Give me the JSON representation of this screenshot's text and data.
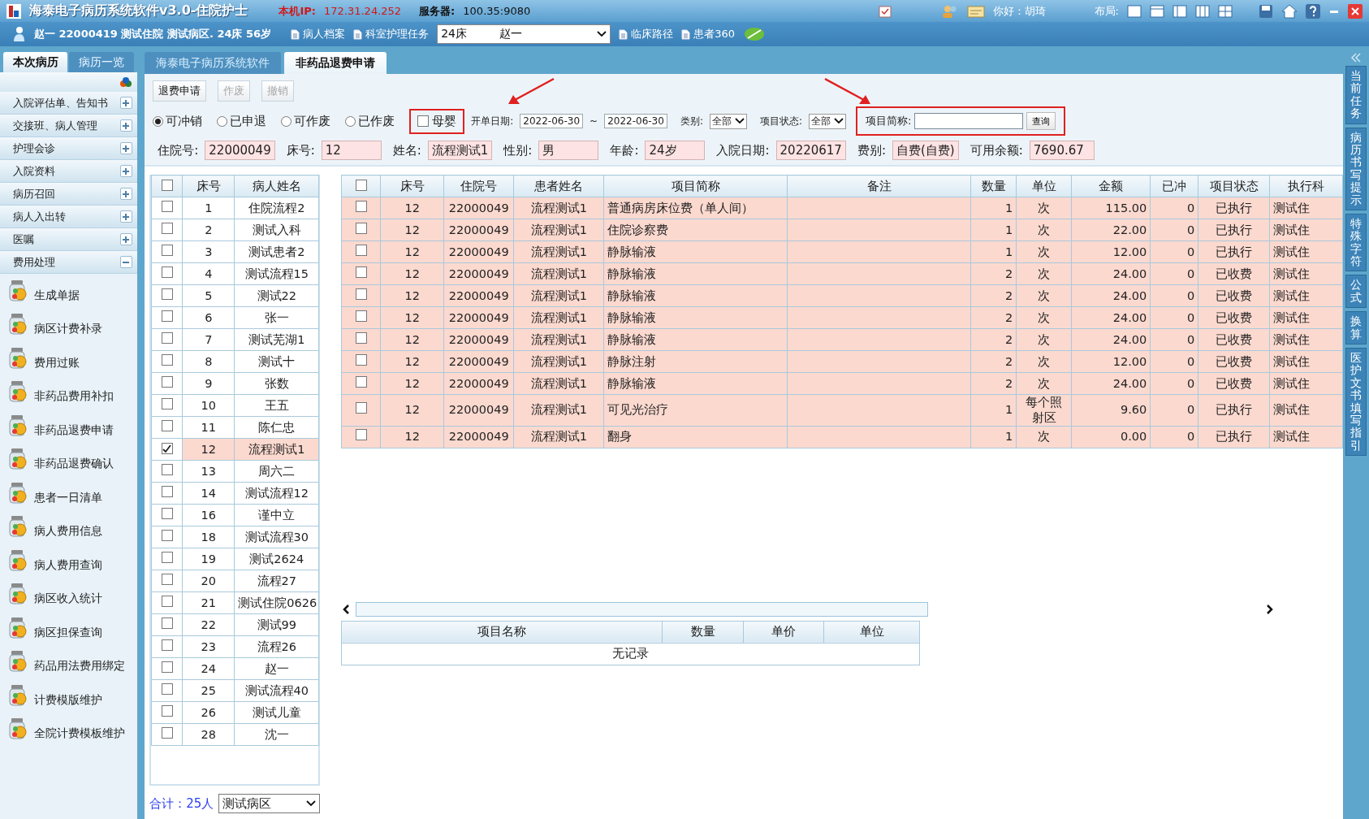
{
  "title_bar": {
    "app_title": "海泰电子病历系统软件v3.0-住院护士",
    "ip_label": "本机IP:",
    "ip": "172.31.24.252",
    "server_label": "服务器:",
    "server": "100.35:9080",
    "greeting": "你好：胡琦",
    "layout_label": "布局:"
  },
  "patient_bar": {
    "patient_info": "赵一  22000419  测试住院  测试病区. 24床  56岁",
    "links_left": [
      "病人档案",
      "科室护理任务"
    ],
    "bed_select": {
      "bed": "24床",
      "name": "赵一"
    },
    "links_right": [
      "临床路径",
      "患者360"
    ]
  },
  "sidebar": {
    "tabs": [
      {
        "label": "本次病历",
        "selected": true
      },
      {
        "label": "病历一览",
        "selected": false
      }
    ],
    "sections": [
      {
        "label": "入院评估单、告知书",
        "expanded": false
      },
      {
        "label": "交接班、病人管理",
        "expanded": false
      },
      {
        "label": "护理会诊",
        "expanded": false
      },
      {
        "label": "入院资料",
        "expanded": false
      },
      {
        "label": "病历召回",
        "expanded": false
      },
      {
        "label": "病人入出转",
        "expanded": false
      },
      {
        "label": "医嘱",
        "expanded": false
      },
      {
        "label": "费用处理",
        "expanded": true,
        "children": [
          "生成单据",
          "病区计费补录",
          "费用过账",
          "非药品费用补扣",
          "非药品退费申请",
          "非药品退费确认",
          "患者一日清单",
          "病人费用信息",
          "病人费用查询",
          "病区收入统计",
          "病区担保查询",
          "药品用法费用绑定",
          "计费模版维护",
          "全院计费模板维护"
        ]
      }
    ]
  },
  "content_tabs": [
    {
      "label": "海泰电子病历系统软件",
      "selected": false
    },
    {
      "label": "非药品退费申请",
      "selected": true
    }
  ],
  "toolbar": {
    "buttons": [
      {
        "label": "退费申请",
        "disabled": false
      },
      {
        "label": "作废",
        "disabled": true
      },
      {
        "label": "撤销",
        "disabled": true
      }
    ]
  },
  "filters": {
    "radios": [
      {
        "label": "可冲销",
        "selected": true
      },
      {
        "label": "已申退",
        "selected": false
      },
      {
        "label": "可作废",
        "selected": false
      },
      {
        "label": "已作废",
        "selected": false
      }
    ],
    "mother_baby": {
      "label": "母婴",
      "checked": false
    },
    "date_label": "开单日期:",
    "date_from": "2022-06-30",
    "date_separator": "~",
    "date_to": "2022-06-30",
    "category_label": "类别:",
    "category": "全部",
    "status_label": "项目状态:",
    "status": "全部",
    "item_label": "项目简称:",
    "query_button": "查询"
  },
  "patient_info": [
    {
      "label": "住院号:",
      "value": "22000049"
    },
    {
      "label": "床号:",
      "value": "12"
    },
    {
      "label": "姓名:",
      "value": "流程测试1"
    },
    {
      "label": "性别:",
      "value": "男"
    },
    {
      "label": "年龄:",
      "value": "24岁"
    },
    {
      "label": "入院日期:",
      "value": "20220617"
    },
    {
      "label": "费别:",
      "value": "自费(自费)"
    },
    {
      "label": "可用余额:",
      "value": "7690.67"
    }
  ],
  "patient_list": {
    "all_checked": false,
    "columns": [
      "床号",
      "病人姓名"
    ],
    "rows": [
      {
        "bed": "1",
        "name": "住院流程2",
        "checked": false
      },
      {
        "bed": "2",
        "name": "测试入科",
        "checked": false
      },
      {
        "bed": "3",
        "name": "测试患者2",
        "checked": false
      },
      {
        "bed": "4",
        "name": "测试流程15",
        "checked": false
      },
      {
        "bed": "5",
        "name": "测试22",
        "checked": false
      },
      {
        "bed": "6",
        "name": "张一",
        "checked": false
      },
      {
        "bed": "7",
        "name": "测试芜湖1",
        "checked": false
      },
      {
        "bed": "8",
        "name": "测试十",
        "checked": false
      },
      {
        "bed": "9",
        "name": "张数",
        "checked": false
      },
      {
        "bed": "10",
        "name": "王五",
        "checked": false
      },
      {
        "bed": "11",
        "name": "陈仁忠",
        "checked": false
      },
      {
        "bed": "12",
        "name": "流程测试1",
        "checked": true
      },
      {
        "bed": "13",
        "name": "周六二",
        "checked": false
      },
      {
        "bed": "14",
        "name": "测试流程12",
        "checked": false
      },
      {
        "bed": "16",
        "name": "谨中立",
        "checked": false
      },
      {
        "bed": "18",
        "name": "测试流程30",
        "checked": false
      },
      {
        "bed": "19",
        "name": "测试2624",
        "checked": false
      },
      {
        "bed": "20",
        "name": "流程27",
        "checked": false
      },
      {
        "bed": "21",
        "name": "测试住院0626",
        "checked": false
      },
      {
        "bed": "22",
        "name": "测试99",
        "checked": false
      },
      {
        "bed": "23",
        "name": "流程26",
        "checked": false
      },
      {
        "bed": "24",
        "name": "赵一",
        "checked": false
      },
      {
        "bed": "25",
        "name": "测试流程40",
        "checked": false
      },
      {
        "bed": "26",
        "name": "测试儿童",
        "checked": false
      },
      {
        "bed": "28",
        "name": "沈一",
        "checked": false
      }
    ],
    "total": "合计：25人",
    "ward": "测试病区"
  },
  "fee_table": {
    "all_checked": false,
    "columns": [
      "床号",
      "住院号",
      "患者姓名",
      "项目简称",
      "备注",
      "数量",
      "单位",
      "金额",
      "已冲",
      "项目状态",
      "执行科"
    ],
    "rows": [
      {
        "checked": false,
        "cells": [
          "12",
          "22000049",
          "流程测试1",
          "普通病房床位费（单人间）",
          "",
          "1",
          "次",
          "115.00",
          "0",
          "已执行",
          "测试住"
        ]
      },
      {
        "checked": false,
        "cells": [
          "12",
          "22000049",
          "流程测试1",
          "住院诊察费",
          "",
          "1",
          "次",
          "22.00",
          "0",
          "已执行",
          "测试住"
        ]
      },
      {
        "checked": false,
        "cells": [
          "12",
          "22000049",
          "流程测试1",
          "静脉输液",
          "",
          "1",
          "次",
          "12.00",
          "0",
          "已执行",
          "测试住"
        ]
      },
      {
        "checked": false,
        "cells": [
          "12",
          "22000049",
          "流程测试1",
          "静脉输液",
          "",
          "2",
          "次",
          "24.00",
          "0",
          "已收费",
          "测试住"
        ]
      },
      {
        "checked": false,
        "cells": [
          "12",
          "22000049",
          "流程测试1",
          "静脉输液",
          "",
          "2",
          "次",
          "24.00",
          "0",
          "已收费",
          "测试住"
        ]
      },
      {
        "checked": false,
        "cells": [
          "12",
          "22000049",
          "流程测试1",
          "静脉输液",
          "",
          "2",
          "次",
          "24.00",
          "0",
          "已收费",
          "测试住"
        ]
      },
      {
        "checked": false,
        "cells": [
          "12",
          "22000049",
          "流程测试1",
          "静脉输液",
          "",
          "2",
          "次",
          "24.00",
          "0",
          "已收费",
          "测试住"
        ]
      },
      {
        "checked": false,
        "cells": [
          "12",
          "22000049",
          "流程测试1",
          "静脉注射",
          "",
          "2",
          "次",
          "12.00",
          "0",
          "已收费",
          "测试住"
        ]
      },
      {
        "checked": false,
        "cells": [
          "12",
          "22000049",
          "流程测试1",
          "静脉输液",
          "",
          "2",
          "次",
          "24.00",
          "0",
          "已收费",
          "测试住"
        ]
      },
      {
        "checked": false,
        "cells": [
          "12",
          "22000049",
          "流程测试1",
          "可见光治疗",
          "",
          "1",
          "每个照射区",
          "9.60",
          "0",
          "已执行",
          "测试住"
        ]
      },
      {
        "checked": false,
        "cells": [
          "12",
          "22000049",
          "流程测试1",
          "翻身",
          "",
          "1",
          "次",
          "0.00",
          "0",
          "已执行",
          "测试住"
        ]
      }
    ]
  },
  "detail_table": {
    "columns": [
      "项目名称",
      "数量",
      "单价",
      "单位"
    ],
    "empty_text": "无记录"
  },
  "right_panel": {
    "tabs": [
      "当前任务",
      "病历书写提示",
      "特殊字符",
      "公式",
      "换算",
      "医护文书填写指引"
    ]
  }
}
